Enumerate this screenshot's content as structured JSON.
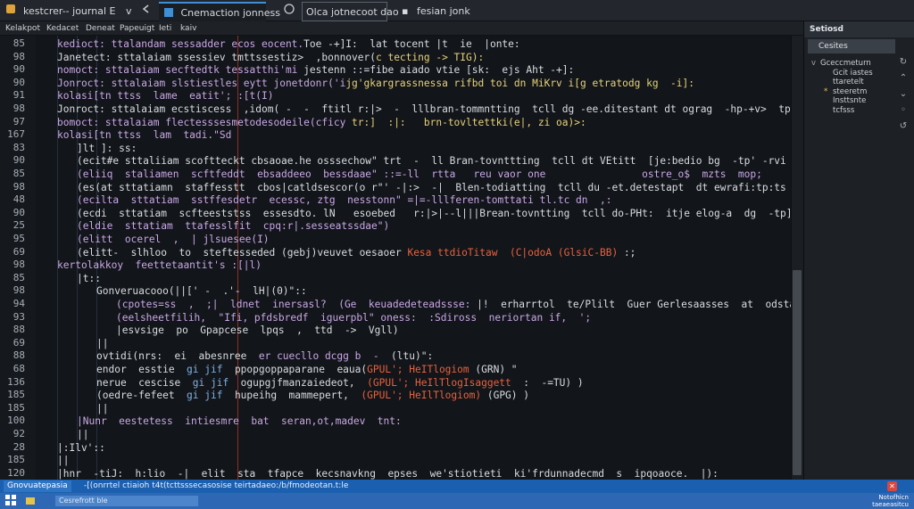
{
  "tabs": [
    {
      "label": "kestcrer-- journal E",
      "dropdown": "v",
      "active": false
    },
    {
      "label": "Cnemaction jonness",
      "dropdown": "",
      "active": true
    },
    {
      "label": "Olca jotnecoot dao",
      "dropdown": "",
      "active": false
    },
    {
      "label": "fesian jonk",
      "dropdown": "",
      "active": false
    }
  ],
  "toolbar": [
    "Kelakpot",
    "Kedacet",
    "Deneat",
    "Papeuigt",
    "Ieti",
    "kaiv"
  ],
  "gutter_lines": [
    "85",
    "98",
    "90",
    "90",
    "91",
    "98",
    "97",
    "167",
    "83",
    "90",
    "85",
    "98",
    "48",
    "90",
    "25",
    "95",
    "69",
    "98",
    "85",
    "98",
    "94",
    "93",
    "88",
    "69",
    "88",
    "68",
    "136",
    "185",
    "185",
    "100",
    "92",
    "28",
    "185",
    "120"
  ],
  "code_lines": [
    {
      "indent": 0,
      "parts": [
        [
          "kedioct: ttalandam sessadder ecos eocent.",
          "#c9a8e8"
        ],
        [
          "Toe -+]I:  lat tocent |t  ie  |onte:",
          "#d9dde2"
        ]
      ]
    },
    {
      "indent": 0,
      "parts": [
        [
          "Janetect: sttalaiam ssessiev tmttssestiz>  ,bonnover(",
          "#d9dde2"
        ],
        [
          "c tecting -> TIG):",
          "#e8d27a"
        ]
      ]
    },
    {
      "indent": 0,
      "parts": [
        [
          "nomoct: sttalaiam secftedtk tessatthi'mi",
          "#c9a8e8"
        ],
        [
          " jestenn ::=fibe aiado vtie [sk:  ejs Aht -+]:",
          "#d9dde2"
        ]
      ]
    },
    {
      "indent": 0,
      "parts": [
        [
          "Jonroct: sttalaiam slstiestles eytt jonetdonr('i",
          "#c9a8e8"
        ],
        [
          "jg'gkargrassnessa rifbd toi dn MiKrv i[g etratodg kg  -i]:",
          "#e8d27a"
        ]
      ]
    },
    {
      "indent": 0,
      "parts": [
        [
          "kolasi[tn ttss  lame  eatit'; :[t(I)",
          "#c9a8e8"
        ]
      ]
    },
    {
      "indent": 0,
      "parts": [
        [
          "Jonroct: sttalaiam ecstiscess  ,idom( -  -  ftitl r:|>  -  lllbran-tommntting  tcll dg -ee.ditestant dt ograg  -hp-+v>  tp] >:",
          "#d9dde2"
        ]
      ]
    },
    {
      "indent": 0,
      "parts": [
        [
          "bomoct: sttalaiam flectesssesmetodesodeile(cficy ",
          "#c9a8e8"
        ],
        [
          "tr:]  :|:   brn-tovltettki(e|, zi oa)>:",
          "#e8d27a"
        ]
      ]
    },
    {
      "indent": 0,
      "parts": [
        [
          "kolasi[tn ttss  lam  tadi.\"Sd",
          "#c9a8e8"
        ]
      ]
    },
    {
      "indent": 1,
      "parts": [
        [
          "]lt ]: ss:",
          "#d9dde2"
        ]
      ]
    },
    {
      "indent": 1,
      "parts": [
        [
          "(ecit#e sttaliiam scoftteckt cbsaoae.he osssechow\" trt  -  ll Bran-tovnttting  tcll dt VEtitt  [je:bedio bg  -tp' -rvi  >tp] >:",
          "#d9dde2"
        ]
      ]
    },
    {
      "indent": 1,
      "parts": [
        [
          "(eliiq  staliamen  scftfeddt  ebsaddeeo  bessdaae\" ::=-ll  rtta   reu vaor one                ostre_o$  mzts  mop;",
          "#c9a8e8"
        ]
      ]
    },
    {
      "indent": 1,
      "parts": [
        [
          "(es(at sttatiamn  staffesstt  cbos|catldsescor(o r\"' -|:>  -|  Blen-todiatting  tcll du -et.detestapt  dt ewrafi:tp:ts  tp] >:",
          "#d9dde2"
        ]
      ]
    },
    {
      "indent": 1,
      "parts": [
        [
          "(ecilta  sttatiam  sstffesdetr  ecessc, ztg  nesstonn\" =|=-lllferen-tomttati tl.tc dn  ,:",
          "#c9a8e8"
        ]
      ]
    },
    {
      "indent": 1,
      "parts": [
        [
          "(ecdi  sttatiam  scfteeststss  essesdto. lN   esoebed   r:|>|--l|||Brean-tovntting  tcll do-PHt:  itje elog-a  dg  -tp]  >]:",
          "#d9dde2"
        ]
      ]
    },
    {
      "indent": 1,
      "parts": [
        [
          "(eldie  sttatiam  ttafesslfit  cpq:r|.sesseatssdae\")",
          "#c9a8e8"
        ]
      ]
    },
    {
      "indent": 1,
      "parts": [
        [
          "(elitt  ocerel  ,  | jlsuesee(I)",
          "#c9a8e8"
        ]
      ]
    },
    {
      "indent": 1,
      "parts": [
        [
          "(elitt-  slhloo  to  steftesseded (gebj)veuvet oesaoer ",
          "#d9dde2"
        ],
        [
          "Kesa ttdioTitaw  (C|odoA (GlsiC-BB) ",
          "#e8613f"
        ],
        [
          ":;",
          "#d9dde2"
        ]
      ]
    },
    {
      "indent": 0,
      "parts": [
        [
          "kertolakkoy  feettetaantit's :[|l)",
          "#c9a8e8"
        ]
      ]
    },
    {
      "indent": 1,
      "parts": [
        [
          "|t::",
          "#d9dde2"
        ]
      ]
    },
    {
      "indent": 2,
      "parts": [
        [
          "Gonveruacooo(||[' -  .'-  lH|(0)\"::",
          "#d9dde2"
        ]
      ]
    },
    {
      "indent": 3,
      "parts": [
        [
          "(cpotes=ss  ,  ;|  ldnet  inersasl?  (Ge  keuadedeteadssse: ",
          "#c9a8e8"
        ],
        [
          "|!  erharrtol  te/Plilt  Guer Gerlesaasses  at  odstaps  tad  -i):",
          "#d9dde2"
        ]
      ]
    },
    {
      "indent": 3,
      "parts": [
        [
          "(eelsheetfilih,  \"Ifi, pfdsbredf  iguerpbl\" oness:  :Sdiross  neriortan if,  '; ",
          "#c9a8e8"
        ]
      ]
    },
    {
      "indent": 3,
      "parts": [
        [
          "|esvsige  po  Gpapcese  lpqs  ,  ttd  ->  Vgll)",
          "#d9dde2"
        ]
      ]
    },
    {
      "indent": 2,
      "parts": [
        [
          "||",
          "#d9dde2"
        ]
      ]
    },
    {
      "indent": 2,
      "parts": [
        [
          "ovtidi(nrs:  ei  abesnree  ",
          "#d9dde2"
        ],
        [
          "er cuecllo dcgg b  -",
          "#c9a8e8"
        ],
        [
          "  (ltu)\":",
          "#d9dde2"
        ]
      ]
    },
    {
      "indent": 2,
      "parts": [
        [
          "endor  esstie  ",
          "#d9dde2"
        ],
        [
          "gi jif  ",
          "#7fb4e8"
        ],
        [
          "ppopgoppaparane  eaua(",
          "#d9dde2"
        ],
        [
          "GPUL'; HeITlogiom",
          "#e8613f"
        ],
        [
          " (GRN) \"",
          "#d9dde2"
        ]
      ]
    },
    {
      "indent": 2,
      "parts": [
        [
          "nerue  cescise  ",
          "#d9dde2"
        ],
        [
          "gi jif  ",
          "#7fb4e8"
        ],
        [
          "ogupgjfmanzaiedeot,  ",
          "#d9dde2"
        ],
        [
          "(GPUL'; HeIlTlogIsaggett",
          "#e8613f"
        ],
        [
          "  :  -=TU) )",
          "#d9dde2"
        ]
      ]
    },
    {
      "indent": 2,
      "parts": [
        [
          "(oedre-fefeet  ",
          "#d9dde2"
        ],
        [
          "gi jif  ",
          "#7fb4e8"
        ],
        [
          "hupeihg  mammepert,  ",
          "#d9dde2"
        ],
        [
          "(GPUL'; HeIlTlogiom)",
          "#e8613f"
        ],
        [
          " (GPG) )",
          "#d9dde2"
        ]
      ]
    },
    {
      "indent": 2,
      "parts": [
        [
          "||",
          "#d9dde2"
        ]
      ]
    },
    {
      "indent": 1,
      "parts": [
        [
          "|Nunr  eestetess  intiesmre  bat  seran,ot,madev  tnt:",
          "#c9a8e8"
        ]
      ]
    },
    {
      "indent": 1,
      "parts": [
        [
          "||",
          "#d9dde2"
        ]
      ]
    },
    {
      "indent": 0,
      "parts": [
        [
          "|:Ilv'::",
          "#d9dde2"
        ]
      ]
    },
    {
      "indent": 0,
      "parts": [
        [
          "||",
          "#d9dde2"
        ]
      ]
    },
    {
      "indent": 0,
      "parts": [
        [
          "|hnr  -tiJ:  h:lio  -|  elit  sta  tfapce  kecsnavkng  epses  we'stiotieti  ki'frdunnadecmd  s  ipqoaoce.  |):",
          "#d9dde2"
        ]
      ]
    }
  ],
  "panel": {
    "title": "Setiosd",
    "subtitle": "Cesites",
    "tree": [
      {
        "twisty": "v",
        "label": "Gceccmeturn"
      },
      {
        "twisty": "",
        "label": "Gcit iastes"
      },
      {
        "twisty": "",
        "label": "ttaretelt"
      },
      {
        "twisty": "*",
        "label": "steeretm"
      },
      {
        "twisty": "",
        "label": "Insttsnte"
      },
      {
        "twisty": "",
        "label": "tcfsss"
      }
    ],
    "icons": [
      "refresh-icon",
      "chevron-up-icon",
      "chevron-down-icon",
      "scroll-icon",
      "sync-icon"
    ]
  },
  "status": {
    "label": "Gnovuatepasia",
    "path": "-[(onrrtel  ctiaioh t4t(tcttsssecasosise  teirtadaeo:/b/fmodeotan.t:le"
  },
  "taskbar": {
    "start": "",
    "search": "Cesrefrott  ble",
    "clock_line1": "Notofhicn",
    "clock_line2": "taeaeasitcu"
  },
  "colors": {
    "accent": "#3d8fd6",
    "guide_red": "#b3362a",
    "status_blue": "#1a5fb0",
    "taskbar_blue": "#2e67b4"
  }
}
